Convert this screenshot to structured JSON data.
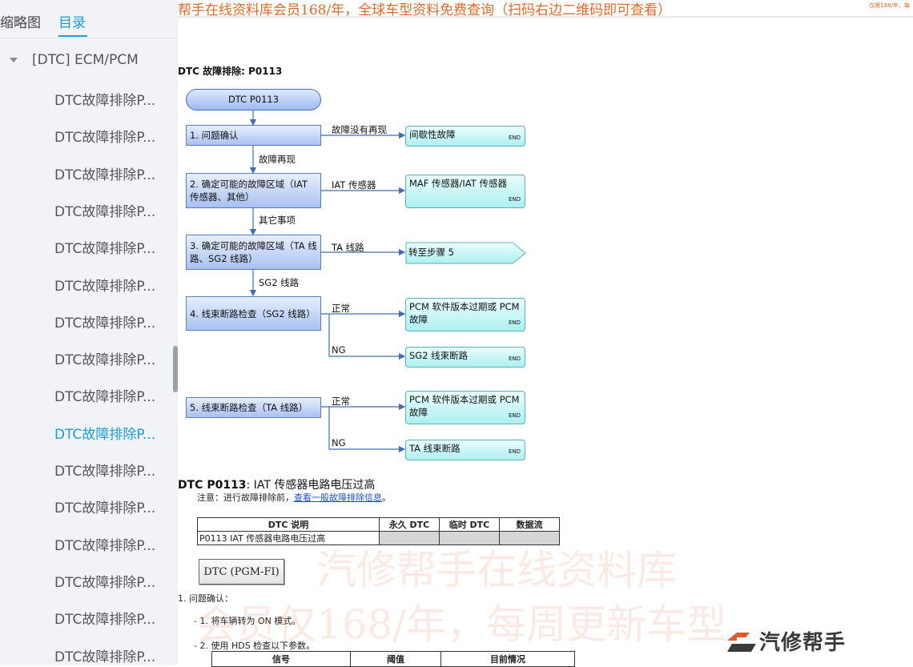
{
  "sidebar": {
    "tabs": [
      "缩略图",
      "目录"
    ],
    "root": "[DTC] ECM/PCM",
    "items": [
      "DTC故障排除P...",
      "DTC故障排除P...",
      "DTC故障排除P...",
      "DTC故障排除P...",
      "DTC故障排除P...",
      "DTC故障排除P...",
      "DTC故障排除P...",
      "DTC故障排除P...",
      "DTC故障排除P...",
      "DTC故障排除P...",
      "DTC故障排除P...",
      "DTC故障排除P...",
      "DTC故障排除P...",
      "DTC故障排除P...",
      "DTC故障排除P...",
      "DTC故障排除P..."
    ],
    "active_index": 9
  },
  "banner": {
    "text": "帮手在线资料库会员168/年，全球车型资料免费查询（扫码右边二维码即可查看）",
    "small": "仅需168/年，每"
  },
  "doc": {
    "header": "DTC 故障排除: P0113",
    "flow": {
      "start": "DTC P0113",
      "steps": [
        "1.  问题确认",
        "2.  确定可能的故障区域（IAT 传感器、其他）",
        "3.  确定可能的故障区域（TA 线路、SG2 线路）",
        "4.  线束断路检查（SG2 线路）",
        "5.  线束断路检查（TA 线路）"
      ],
      "ends": [
        "间歇性故障",
        "MAF 传感器/IAT 传感器",
        "转至步骤 5",
        "PCM 软件版本过期或 PCM 故障",
        "SG2 线束断路",
        "PCM 软件版本过期或 PCM 故障",
        "TA 线束断路"
      ],
      "end_tag": "END",
      "labels": {
        "l1_side": "故障没有再现",
        "l1_down": "故障再现",
        "l2_side": "IAT 传感器",
        "l2_down": "其它事项",
        "l3_side": "TA 线路",
        "l3_down": "SG2 线路",
        "ok": "正常",
        "ng": "NG"
      }
    },
    "title_code": "DTC P0113",
    "title_rest": ": IAT 传感器电路电压过高",
    "note_prefix": "注意：进行故障排除前，",
    "note_link": "查看一般故障排除信息",
    "note_suffix": "。",
    "desc_table": {
      "headers": [
        "DTC 说明",
        "永久 DTC",
        "临时 DTC",
        "数据流"
      ],
      "row": [
        "P0113 IAT 传感器电路电压过高",
        "",
        "",
        ""
      ]
    },
    "button": "DTC (PGM-FI)",
    "step1_title": "1.  问题确认：",
    "step1_lines": [
      "- 1. 将车辆转为 ON 模式。",
      "- 2. 使用 HDS 检查以下参数。"
    ],
    "params_headers": [
      "信号",
      "阈值",
      "目前情况"
    ]
  },
  "watermark": [
    "汽修帮手在线资料库",
    "会员仅168/年，每周更新车型"
  ],
  "logo_text": "汽修帮手",
  "colors": {
    "accent": "#1a9cd8",
    "banner": "#e06a2a"
  }
}
